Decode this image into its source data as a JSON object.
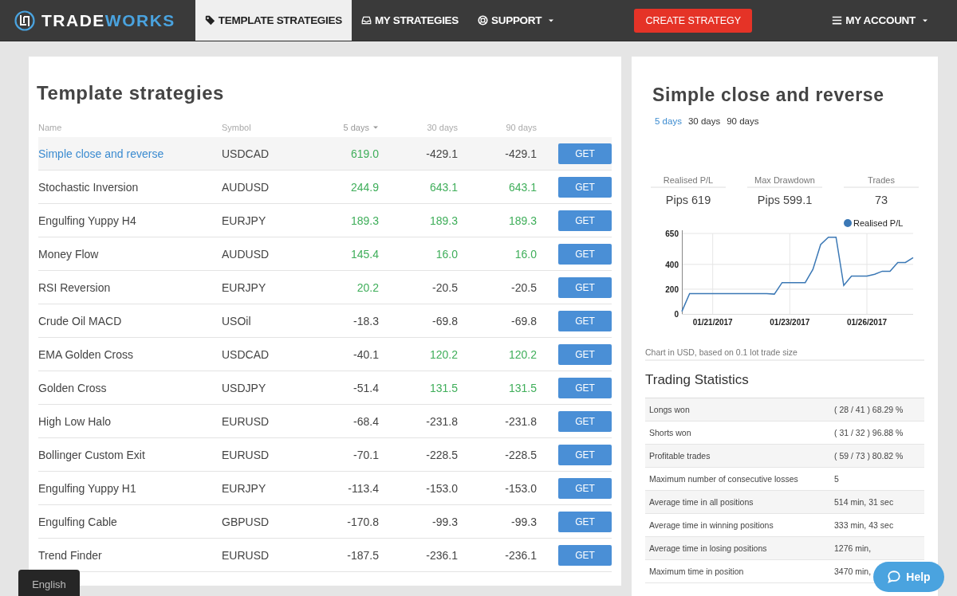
{
  "nav": {
    "brand_prefix": "TRADE",
    "brand_suffix": "WORKS",
    "items": [
      {
        "label": "TEMPLATE STRATEGIES",
        "dropdown": false,
        "selected": true
      },
      {
        "label": "MY STRATEGIES",
        "dropdown": false,
        "selected": false
      },
      {
        "label": "SUPPORT",
        "dropdown": true,
        "selected": false
      }
    ],
    "create_button": "CREATE STRATEGY",
    "account": "MY ACCOUNT"
  },
  "strategies": {
    "title": "Template strategies",
    "columns": [
      {
        "label": "Name",
        "sorted": false
      },
      {
        "label": "Symbol",
        "sorted": false
      },
      {
        "label": "5 days",
        "sorted": true
      },
      {
        "label": "30 days",
        "sorted": false
      },
      {
        "label": "90 days",
        "sorted": false
      }
    ],
    "rows": [
      {
        "name": "Simple close and reverse",
        "symbol": "USDCAD",
        "selected": true,
        "values": [
          {
            "text": "619.0",
            "positive": true
          },
          {
            "text": "-429.1",
            "positive": false
          },
          {
            "text": "-429.1",
            "positive": false
          }
        ],
        "button": "GET"
      },
      {
        "name": "Stochastic Inversion",
        "symbol": "AUDUSD",
        "selected": false,
        "values": [
          {
            "text": "244.9",
            "positive": true
          },
          {
            "text": "643.1",
            "positive": true
          },
          {
            "text": "643.1",
            "positive": true
          }
        ],
        "button": "GET"
      },
      {
        "name": "Engulfing Yuppy H4",
        "symbol": "EURJPY",
        "selected": false,
        "values": [
          {
            "text": "189.3",
            "positive": true
          },
          {
            "text": "189.3",
            "positive": true
          },
          {
            "text": "189.3",
            "positive": true
          }
        ],
        "button": "GET"
      },
      {
        "name": "Money Flow",
        "symbol": "AUDUSD",
        "selected": false,
        "values": [
          {
            "text": "145.4",
            "positive": true
          },
          {
            "text": "16.0",
            "positive": true
          },
          {
            "text": "16.0",
            "positive": true
          }
        ],
        "button": "GET"
      },
      {
        "name": "RSI Reversion",
        "symbol": "EURJPY",
        "selected": false,
        "values": [
          {
            "text": "20.2",
            "positive": true
          },
          {
            "text": "-20.5",
            "positive": false
          },
          {
            "text": "-20.5",
            "positive": false
          }
        ],
        "button": "GET"
      },
      {
        "name": "Crude Oil MACD",
        "symbol": "USOil",
        "selected": false,
        "values": [
          {
            "text": "-18.3",
            "positive": false
          },
          {
            "text": "-69.8",
            "positive": false
          },
          {
            "text": "-69.8",
            "positive": false
          }
        ],
        "button": "GET"
      },
      {
        "name": "EMA Golden Cross",
        "symbol": "USDCAD",
        "selected": false,
        "values": [
          {
            "text": "-40.1",
            "positive": false
          },
          {
            "text": "120.2",
            "positive": true
          },
          {
            "text": "120.2",
            "positive": true
          }
        ],
        "button": "GET"
      },
      {
        "name": "Golden Cross",
        "symbol": "USDJPY",
        "selected": false,
        "values": [
          {
            "text": "-51.4",
            "positive": false
          },
          {
            "text": "131.5",
            "positive": true
          },
          {
            "text": "131.5",
            "positive": true
          }
        ],
        "button": "GET"
      },
      {
        "name": "High Low Halo",
        "symbol": "EURUSD",
        "selected": false,
        "values": [
          {
            "text": "-68.4",
            "positive": false
          },
          {
            "text": "-231.8",
            "positive": false
          },
          {
            "text": "-231.8",
            "positive": false
          }
        ],
        "button": "GET"
      },
      {
        "name": "Bollinger Custom Exit",
        "symbol": "EURUSD",
        "selected": false,
        "values": [
          {
            "text": "-70.1",
            "positive": false
          },
          {
            "text": "-228.5",
            "positive": false
          },
          {
            "text": "-228.5",
            "positive": false
          }
        ],
        "button": "GET"
      },
      {
        "name": "Engulfing Yuppy H1",
        "symbol": "EURJPY",
        "selected": false,
        "values": [
          {
            "text": "-113.4",
            "positive": false
          },
          {
            "text": "-153.0",
            "positive": false
          },
          {
            "text": "-153.0",
            "positive": false
          }
        ],
        "button": "GET"
      },
      {
        "name": "Engulfing Cable",
        "symbol": "GBPUSD",
        "selected": false,
        "values": [
          {
            "text": "-170.8",
            "positive": false
          },
          {
            "text": "-99.3",
            "positive": false
          },
          {
            "text": "-99.3",
            "positive": false
          }
        ],
        "button": "GET"
      },
      {
        "name": "Trend Finder",
        "symbol": "EURUSD",
        "selected": false,
        "values": [
          {
            "text": "-187.5",
            "positive": false
          },
          {
            "text": "-236.1",
            "positive": false
          },
          {
            "text": "-236.1",
            "positive": false
          }
        ],
        "button": "GET"
      }
    ]
  },
  "detail": {
    "title": "Simple close and reverse",
    "periods": [
      {
        "label": "5 days",
        "selected": true
      },
      {
        "label": "30 days",
        "selected": false
      },
      {
        "label": "90 days",
        "selected": false
      }
    ],
    "summary": [
      {
        "label": "Realised P/L",
        "value": "Pips 619"
      },
      {
        "label": "Max Drawdown",
        "value": "Pips 599.1"
      },
      {
        "label": "Trades",
        "value": "73"
      }
    ],
    "chart_data": {
      "type": "line",
      "categories": [
        null,
        null,
        null,
        null,
        "01/21/2017",
        null,
        null,
        null,
        null,
        null,
        null,
        null,
        null,
        null,
        "01/23/2017",
        null,
        null,
        null,
        null,
        null,
        null,
        null,
        null,
        null,
        "01/26/2017",
        null,
        null,
        null,
        null,
        null,
        null
      ],
      "series": [
        {
          "name": "Realised P/L",
          "color": "#3b78b5",
          "values": [
            20,
            165,
            165,
            165,
            165,
            165,
            165,
            165,
            165,
            165,
            165,
            165,
            160,
            253,
            253,
            253,
            253,
            360,
            560,
            620,
            620,
            230,
            305,
            305,
            305,
            320,
            345,
            345,
            415,
            415,
            455
          ]
        }
      ],
      "ylim": [
        0,
        650
      ],
      "yticks": [
        0,
        200,
        400,
        650
      ],
      "grid": true
    },
    "caption": "Chart in USD, based on 0.1 lot trade size",
    "stats_title": "Trading Statistics",
    "stats": [
      {
        "label": "Longs won",
        "value": "( 28 / 41 ) 68.29 %"
      },
      {
        "label": "Shorts won",
        "value": "( 31 / 32 ) 96.88 %"
      },
      {
        "label": "Profitable trades",
        "value": "( 59 / 73 ) 80.82 %"
      },
      {
        "label": "Maximum number of consecutive losses",
        "value": "5"
      },
      {
        "label": "Average time in all positions",
        "value": "514 min, 31 sec"
      },
      {
        "label": "Average time in winning positions",
        "value": "333 min, 43 sec"
      },
      {
        "label": "Average time in losing positions",
        "value": "1276 min,"
      },
      {
        "label": "Maximum time in position",
        "value": "3470 min,"
      }
    ]
  },
  "language": "English",
  "help_button": "Help"
}
